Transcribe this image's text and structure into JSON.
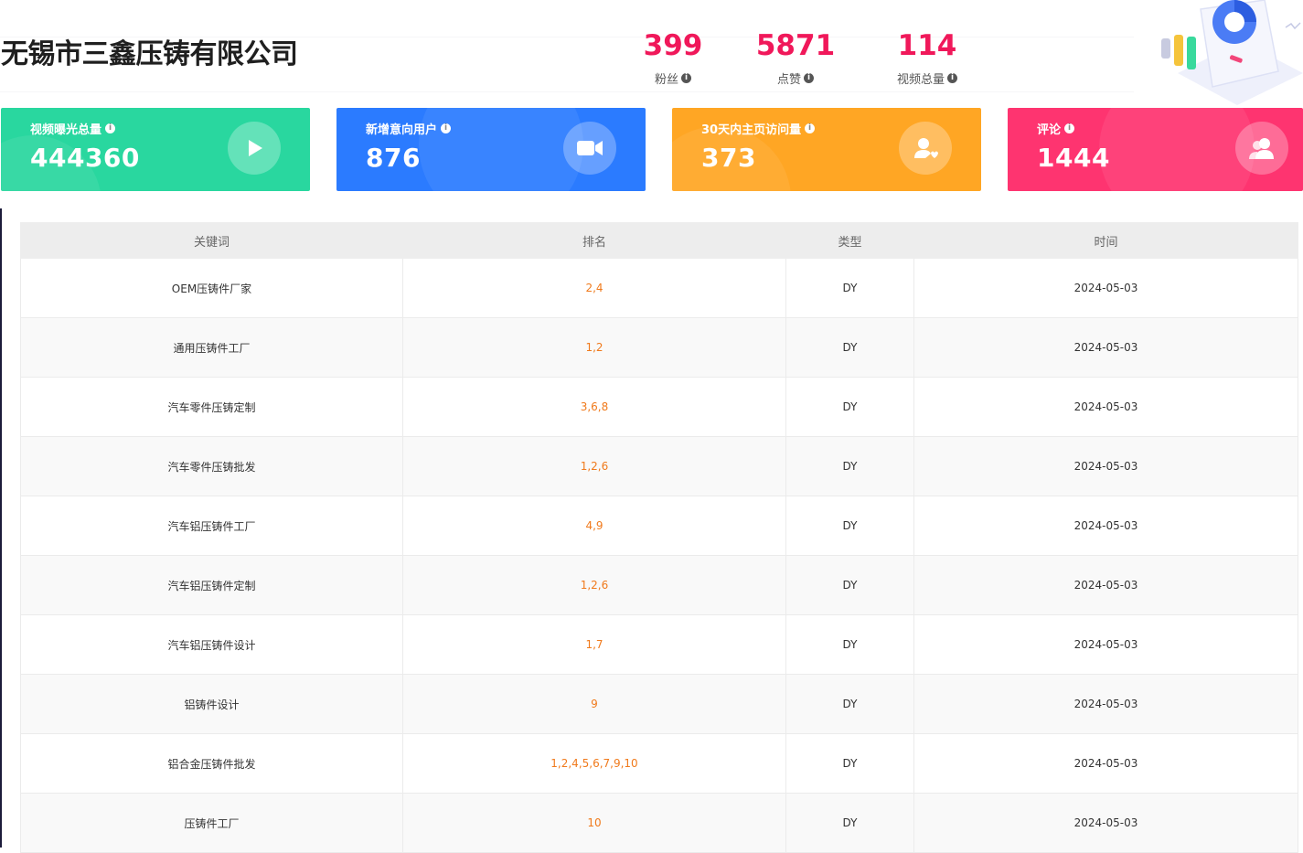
{
  "header": {
    "company_name": "无锡市三鑫压铸有限公司",
    "stats": [
      {
        "value": "399",
        "label": "粉丝"
      },
      {
        "value": "5871",
        "label": "点赞"
      },
      {
        "value": "114",
        "label": "视频总量"
      }
    ],
    "stat_color": "#f0185a"
  },
  "cards": [
    {
      "title": "视频曝光总量",
      "value": "444360",
      "color": "#29d79f",
      "icon": "play-icon"
    },
    {
      "title": "新增意向用户",
      "value": "876",
      "color": "#2b7bff",
      "icon": "video-camera-icon"
    },
    {
      "title": "30天内主页访问量",
      "value": "373",
      "color": "#ffa624",
      "icon": "user-heart-icon"
    },
    {
      "title": "评论",
      "value": "1444",
      "color": "#fe3470",
      "icon": "users-icon"
    }
  ],
  "table": {
    "headers": [
      "关键词",
      "排名",
      "类型",
      "时间"
    ],
    "rows": [
      {
        "keyword": "OEM压铸件厂家",
        "rank": "2,4",
        "type": "DY",
        "date": "2024-05-03"
      },
      {
        "keyword": "通用压铸件工厂",
        "rank": "1,2",
        "type": "DY",
        "date": "2024-05-03"
      },
      {
        "keyword": "汽车零件压铸定制",
        "rank": "3,6,8",
        "type": "DY",
        "date": "2024-05-03"
      },
      {
        "keyword": "汽车零件压铸批发",
        "rank": "1,2,6",
        "type": "DY",
        "date": "2024-05-03"
      },
      {
        "keyword": "汽车铝压铸件工厂",
        "rank": "4,9",
        "type": "DY",
        "date": "2024-05-03"
      },
      {
        "keyword": "汽车铝压铸件定制",
        "rank": "1,2,6",
        "type": "DY",
        "date": "2024-05-03"
      },
      {
        "keyword": "汽车铝压铸件设计",
        "rank": "1,7",
        "type": "DY",
        "date": "2024-05-03"
      },
      {
        "keyword": "铝铸件设计",
        "rank": "9",
        "type": "DY",
        "date": "2024-05-03"
      },
      {
        "keyword": "铝合金压铸件批发",
        "rank": "1,2,4,5,6,7,9,10",
        "type": "DY",
        "date": "2024-05-03"
      },
      {
        "keyword": "压铸件工厂",
        "rank": "10",
        "type": "DY",
        "date": "2024-05-03"
      }
    ],
    "rank_color": "#f07a1c"
  }
}
